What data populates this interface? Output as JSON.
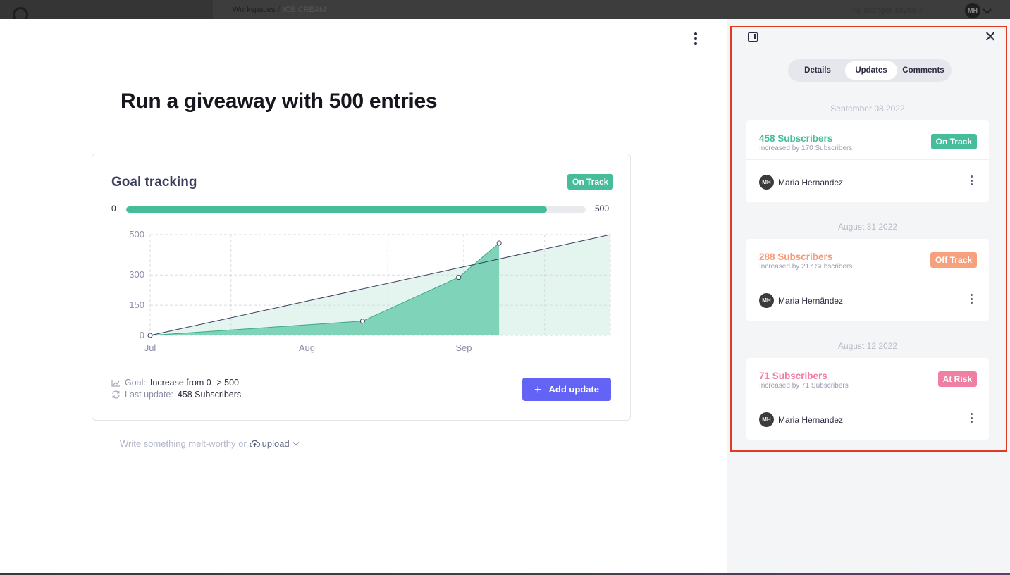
{
  "backdrop": {
    "breadcrumb_root": "Workspaces",
    "breadcrumb_sep": "/",
    "breadcrumb_current": "ICE CREAM",
    "saved_status": "All changes saved ✓",
    "user_initials": "MH"
  },
  "main": {
    "title": "Run a giveaway with 500 entries",
    "goal": {
      "heading": "Goal tracking",
      "status": "On Track",
      "progress_min": "0",
      "progress_max": "500",
      "progress_value": 458,
      "progress_fraction": 0.916,
      "goal_label": "Goal:",
      "goal_value": "Increase from 0 -> 500",
      "last_update_label": "Last update:",
      "last_update_value": "458 Subscribers",
      "add_button": "Add update"
    },
    "composer": {
      "placeholder": "Write something melt-worthy or",
      "upload_label": "upload"
    }
  },
  "chart_data": {
    "type": "area",
    "x_tick_labels": [
      "Jul",
      "Aug",
      "Sep"
    ],
    "y_tick_labels": [
      "0",
      "150",
      "300",
      "500"
    ],
    "ylim": [
      0,
      500
    ],
    "series": [
      {
        "values": [
          {
            "x": "Jul 01",
            "y": 0
          },
          {
            "x": "Aug 12",
            "y": 71
          },
          {
            "x": "Aug 31",
            "y": 288
          },
          {
            "x": "Sep 08",
            "y": 458
          }
        ]
      }
    ],
    "target_line": [
      {
        "x": "Jul 01",
        "y": 0
      },
      {
        "x": "Sep 30",
        "y": 500
      }
    ],
    "grid": true,
    "colors": {
      "actual": "#45bc9a",
      "target_fill": "#e4f5ef",
      "target_line": "#3a3d5c"
    }
  },
  "side": {
    "tabs": [
      {
        "label": "Details"
      },
      {
        "label": "Updates",
        "active": true
      },
      {
        "label": "Comments"
      }
    ],
    "updates": [
      {
        "date": "September 08 2022",
        "title": "458 Subscribers",
        "subtitle": "Increased by 170 Subscribers",
        "status": "On Track",
        "status_color": "green",
        "user_initials": "MH",
        "user_name": "Maria Hernandez"
      },
      {
        "date": "August 31 2022",
        "title": "288 Subscribers",
        "subtitle": "Increased by 217 Subscribers",
        "status": "Off Track",
        "status_color": "orange",
        "user_initials": "MH",
        "user_name": "Maria Hernãndez"
      },
      {
        "date": "August 12 2022",
        "title": "71 Subscribers",
        "subtitle": "Increased by 71 Subscribers",
        "status": "At Risk",
        "status_color": "pink",
        "user_initials": "MH",
        "user_name": "Maria Hernandez"
      }
    ]
  }
}
